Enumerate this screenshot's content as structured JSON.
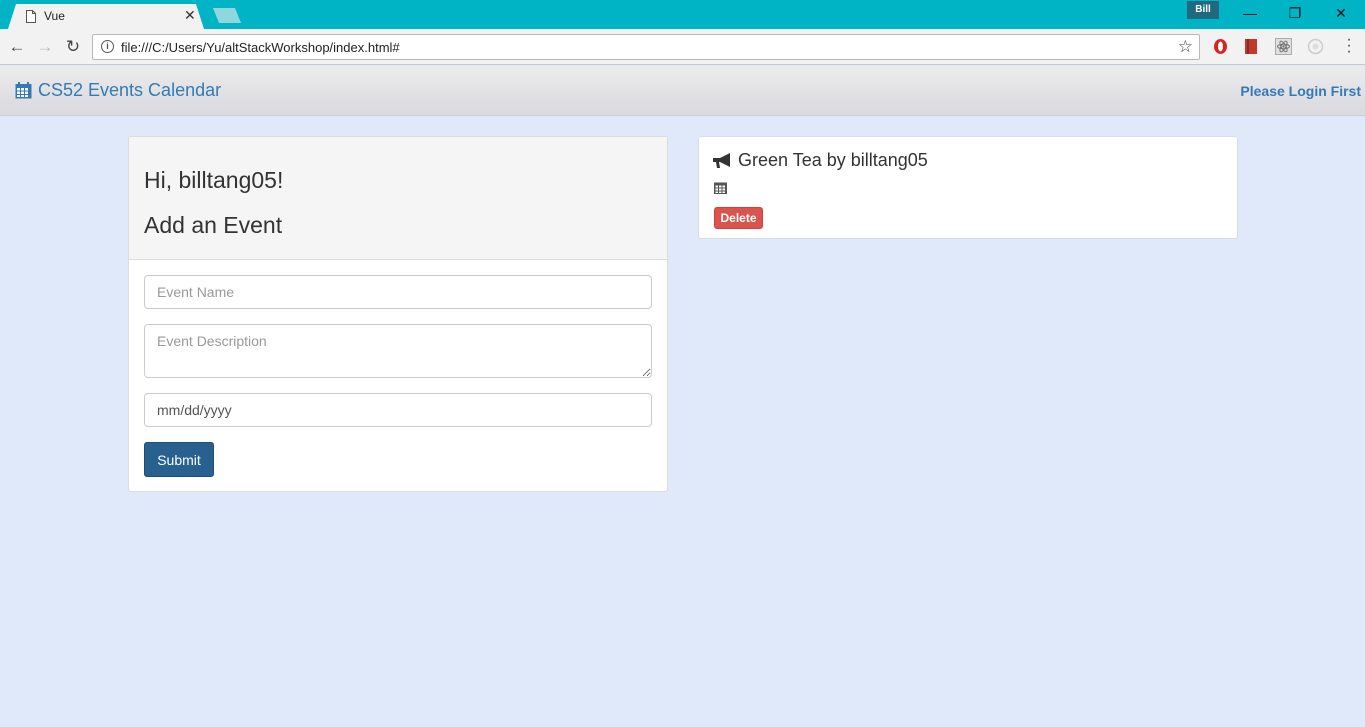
{
  "browser": {
    "tab_title": "Vue",
    "tab_close": "✕",
    "profile_name": "Bill",
    "minimize": "—",
    "restore": "❐",
    "close": "✕",
    "back": "←",
    "forward": "→",
    "reload": "↻",
    "url": "file:///C:/Users/Yu/altStackWorkshop/index.html#",
    "info": "i",
    "bookmark_star": "☆"
  },
  "navbar": {
    "brand": "CS52 Events Calendar",
    "login": "Please Login First"
  },
  "add_panel": {
    "greeting": "Hi, billtang05!",
    "title": "Add an Event",
    "event_name_placeholder": "Event Name",
    "event_description_placeholder": "Event Description",
    "date_placeholder": "mm/dd/yyyy",
    "submit_label": "Submit"
  },
  "events": [
    {
      "title": "Green Tea by billtang05",
      "delete_label": "Delete"
    }
  ],
  "colors": {
    "link_blue": "#337ab7",
    "primary_button": "#286090",
    "danger_button": "#d9534f",
    "page_background": "#e0e9f9",
    "chrome_frame": "#00b4c6"
  }
}
